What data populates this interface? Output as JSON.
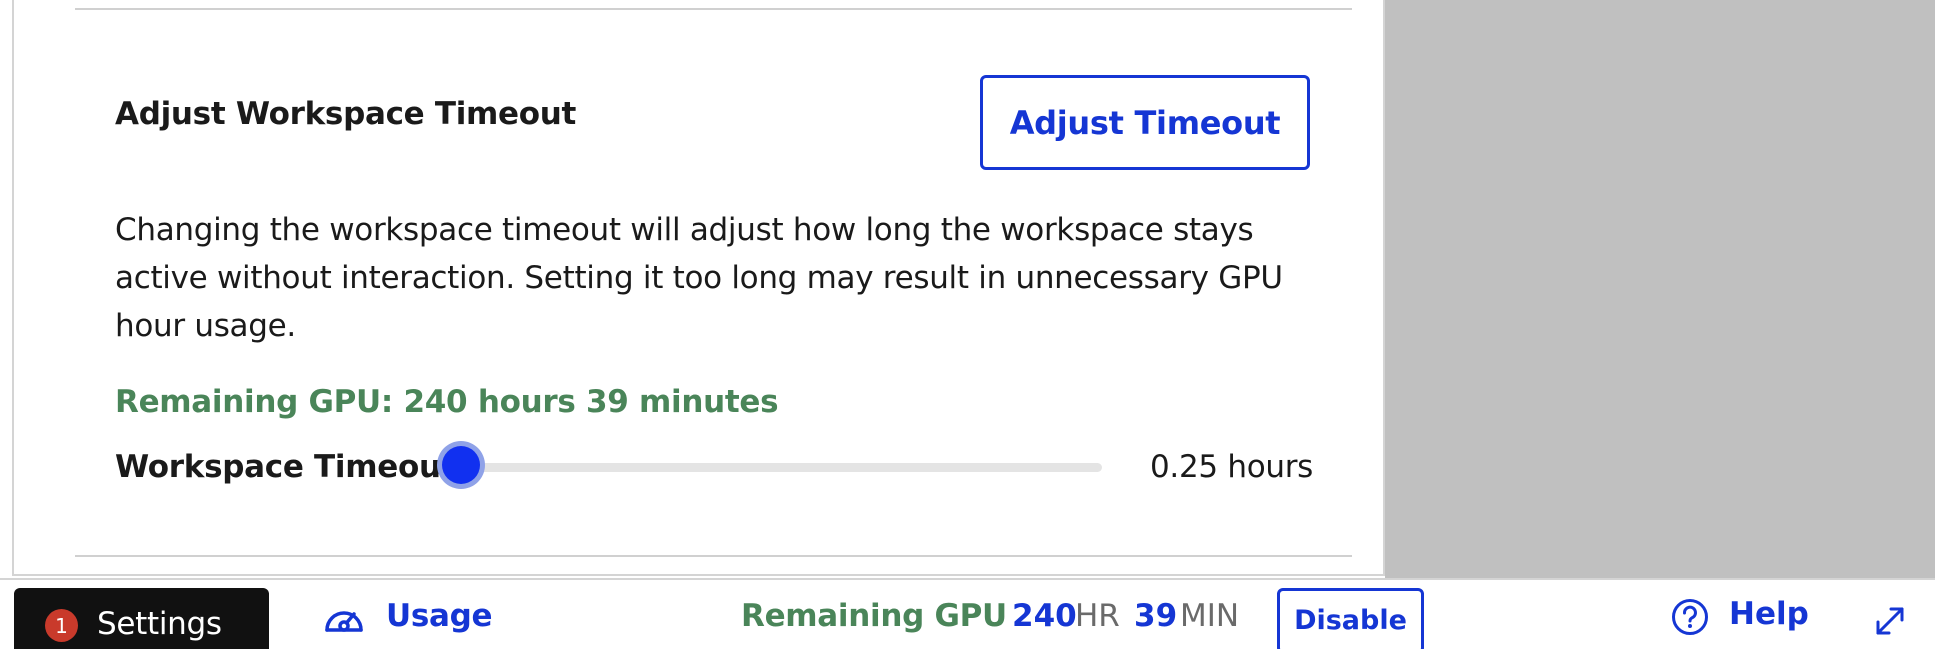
{
  "timeout_section": {
    "title": "Adjust Workspace Timeout",
    "adjust_button_label": "Adjust Timeout",
    "description": "Changing the workspace timeout will adjust how long the workspace stays active without interaction. Setting it too long may result in unnecessary GPU hour usage.",
    "remaining_gpu_text": "Remaining GPU: 240 hours 39 minutes",
    "slider_label": "Workspace Timeout",
    "slider_value_text": "0.25 hours",
    "slider_fraction": 0.0,
    "accent_color": "#1536d4",
    "remaining_color": "#4a8559"
  },
  "bottom_bar": {
    "settings": {
      "badge_count": "1",
      "label": "Settings",
      "icon": "notification-badge"
    },
    "usage": {
      "label": "Usage",
      "icon": "gauge-icon"
    },
    "remaining": {
      "label": "Remaining GPU",
      "hours_value": "240",
      "hours_unit": "HR",
      "minutes_value": "39",
      "minutes_unit": "MIN"
    },
    "disable_label": "Disable",
    "help": {
      "label": "Help",
      "icon": "question-circle-icon"
    },
    "expand_icon": "expand-arrows-icon"
  }
}
